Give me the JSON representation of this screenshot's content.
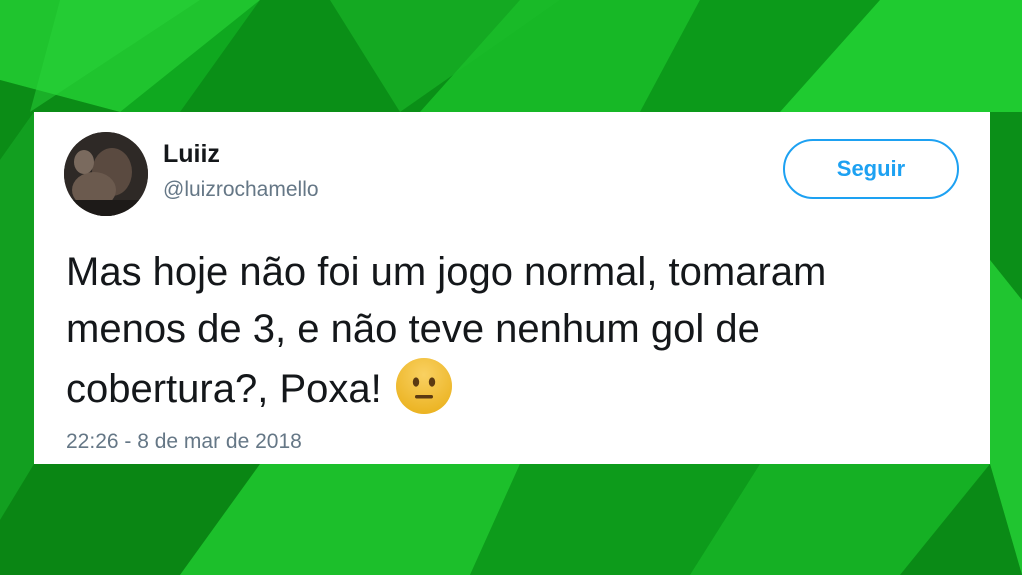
{
  "tweet": {
    "display_name": "Luiiz",
    "handle": "@luizrochamello",
    "follow_label": "Seguir",
    "text_lines": [
      "Mas hoje não foi um jogo normal, tomaram",
      "menos de 3, e não teve nenhum gol de",
      "cobertura?, Poxa!"
    ],
    "emoji": "neutral-face-emoji",
    "timestamp": "22:26 - 8 de mar de 2018"
  },
  "colors": {
    "background_green": "#0fa81f",
    "accent_blue": "#1da1f2",
    "text_dark": "#14171a",
    "text_muted": "#657786",
    "emoji_yellow": "#f7c12d"
  }
}
